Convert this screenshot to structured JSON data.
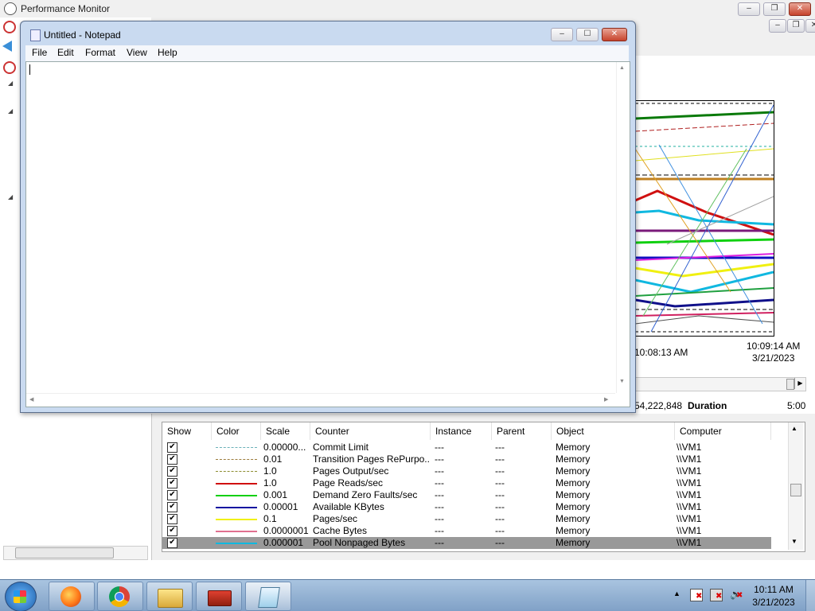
{
  "perfmon": {
    "title": "Performance Monitor",
    "graph": {
      "time_left": "10:08:13 AM",
      "time_right": "10:09:14 AM",
      "date_right": "3/21/2023",
      "stat_value": "54,222,848",
      "duration_label": "Duration",
      "duration_value": "5:00"
    },
    "table": {
      "headers": [
        "Show",
        "Color",
        "Scale",
        "Counter",
        "Instance",
        "Parent",
        "Object",
        "Computer"
      ],
      "rows": [
        {
          "scale": "0.00000...",
          "counter": "Commit Limit",
          "instance": "---",
          "parent": "---",
          "object": "Memory",
          "computer": "\\\\VM1",
          "color": "#6ab0b8",
          "style": "dashed"
        },
        {
          "scale": "0.01",
          "counter": "Transition Pages RePurpo...",
          "instance": "---",
          "parent": "---",
          "object": "Memory",
          "computer": "\\\\VM1",
          "color": "#9c7c3c",
          "style": "dashed"
        },
        {
          "scale": "1.0",
          "counter": "Pages Output/sec",
          "instance": "---",
          "parent": "---",
          "object": "Memory",
          "computer": "\\\\VM1",
          "color": "#8c8c30",
          "style": "dashed"
        },
        {
          "scale": "1.0",
          "counter": "Page Reads/sec",
          "instance": "---",
          "parent": "---",
          "object": "Memory",
          "computer": "\\\\VM1",
          "color": "#d01010",
          "style": "solid"
        },
        {
          "scale": "0.001",
          "counter": "Demand Zero Faults/sec",
          "instance": "---",
          "parent": "---",
          "object": "Memory",
          "computer": "\\\\VM1",
          "color": "#10d010",
          "style": "solid"
        },
        {
          "scale": "0.00001",
          "counter": "Available KBytes",
          "instance": "---",
          "parent": "---",
          "object": "Memory",
          "computer": "\\\\VM1",
          "color": "#1010a0",
          "style": "solid"
        },
        {
          "scale": "0.1",
          "counter": "Pages/sec",
          "instance": "---",
          "parent": "---",
          "object": "Memory",
          "computer": "\\\\VM1",
          "color": "#f0f010",
          "style": "solid"
        },
        {
          "scale": "0.0000001",
          "counter": "Cache Bytes",
          "instance": "---",
          "parent": "---",
          "object": "Memory",
          "computer": "\\\\VM1",
          "color": "#e07090",
          "style": "solid"
        },
        {
          "scale": "0.000001",
          "counter": "Pool Nonpaged Bytes",
          "instance": "---",
          "parent": "---",
          "object": "Memory",
          "computer": "\\\\VM1",
          "color": "#10b8e0",
          "style": "solid",
          "selected": true
        }
      ]
    }
  },
  "notepad": {
    "title": "Untitled - Notepad",
    "menu": [
      "File",
      "Edit",
      "Format",
      "View",
      "Help"
    ],
    "content": ""
  },
  "taskbar": {
    "time": "10:11 AM",
    "date": "3/21/2023",
    "apps": [
      "firefox-icon",
      "chrome-icon",
      "file-explorer-icon",
      "toolbox-icon",
      "notepad-icon"
    ]
  }
}
